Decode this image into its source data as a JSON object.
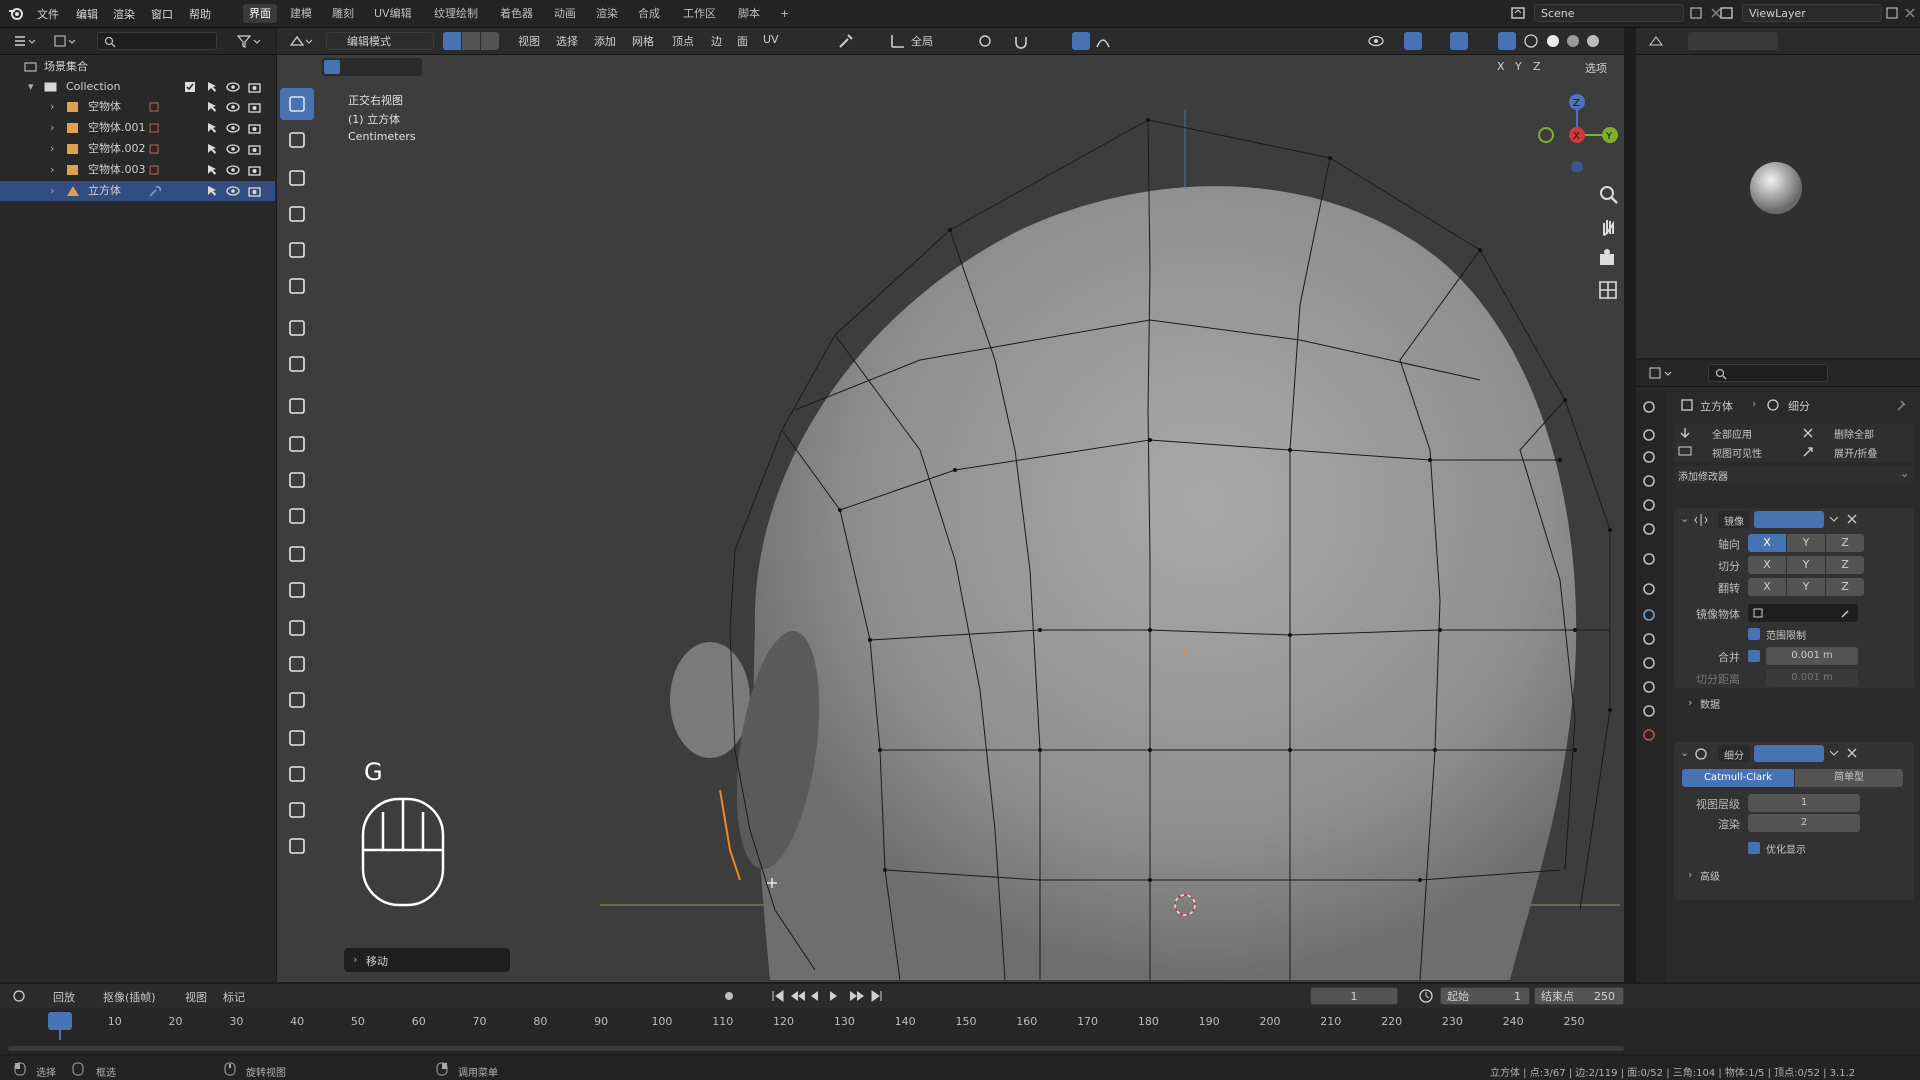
{
  "menubar": {
    "menus": [
      "文件",
      "编辑",
      "渲染",
      "窗口",
      "帮助"
    ],
    "workspaces": [
      "界面",
      "建模",
      "雕刻",
      "UV编辑",
      "纹理绘制",
      "着色器",
      "动画",
      "渲染",
      "合成",
      "工作区",
      "脚本",
      "+"
    ],
    "active_workspace": "界面",
    "scene_label": "Scene",
    "viewlayer_label": "ViewLayer"
  },
  "outliner": {
    "root": "场景集合",
    "collection": "Collection",
    "items": [
      "空物体",
      "空物体.001",
      "空物体.002",
      "空物体.003",
      "立方体"
    ],
    "selected_item": "立方体"
  },
  "viewport_header": {
    "mode": "编辑模式",
    "menus": [
      "视图",
      "选择",
      "添加",
      "网格",
      "顶点",
      "边",
      "面",
      "UV"
    ],
    "transform_orientation": "全局",
    "axis_labels": [
      "X",
      "Y",
      "Z"
    ],
    "options": "选项"
  },
  "viewport": {
    "view_name": "正交右视图",
    "object_label": "(1) 立方体",
    "units": "Centimeters",
    "key_hint": "G",
    "last_operator": "移动"
  },
  "properties": {
    "breadcrumb_object": "立方体",
    "breadcrumb_modifier": "细分",
    "apply_all": "全部应用",
    "delete_all": "删除全部",
    "viewport_vis": "视图可见性",
    "expand_collapse": "展开/折叠",
    "add_modifier": "添加修改器",
    "mirror": {
      "name": "镜像",
      "axis_label": "轴向",
      "bisect_label": "切分",
      "flip_label": "翻转",
      "mirror_object_label": "镜像物体",
      "clipping_label": "范围限制",
      "merge_label": "合并",
      "merge_value": "0.001 m",
      "bisect_dist_label": "切分距离",
      "bisect_dist_value": "0.001 m",
      "data_label": "数据"
    },
    "subdivision": {
      "name": "细分",
      "mode_catmull": "Catmull-Clark",
      "mode_simple": "简单型",
      "viewport_levels_label": "视图层级",
      "viewport_levels_value": "1",
      "render_label": "渲染",
      "render_value": "2",
      "optimal_display_label": "优化显示",
      "advanced_label": "高级"
    }
  },
  "timeline": {
    "menus": [
      "回放",
      "抠像(插帧)",
      "视图",
      "标记"
    ],
    "current_frame": "1",
    "start_label": "起始",
    "start_value": "1",
    "end_label": "结束点",
    "end_value": "250",
    "ticks": [
      "1",
      "10",
      "20",
      "30",
      "40",
      "50",
      "60",
      "70",
      "80",
      "90",
      "100",
      "110",
      "120",
      "130",
      "140",
      "150",
      "160",
      "170",
      "180",
      "190",
      "200",
      "210",
      "220",
      "230",
      "240",
      "250"
    ]
  },
  "statusbar": {
    "select": "选择",
    "box_select": "框选",
    "rotate_view": "旋转视图",
    "call_menu": "调用菜单",
    "stats": "立方体 | 点:3/67 | 边:2/119 | 面:0/52 | 三角:104 | 物体:1/5 | 顶点:0/52 | 3.1.2"
  },
  "colors": {
    "accent": "#4772b3",
    "selection": "#334d80",
    "viewport_bg": "#3d3d3d",
    "edge_select": "#e8892a"
  },
  "icons": [
    "blender-logo-icon",
    "search-icon",
    "filter-icon",
    "eye-icon",
    "camera-icon",
    "cursor-icon",
    "select-box-icon",
    "move-icon",
    "rotate-icon",
    "scale-icon",
    "transform-icon",
    "annotate-icon",
    "measure-icon",
    "add-cube-icon",
    "extrude-icon",
    "inset-icon",
    "bevel-icon",
    "loopcut-icon",
    "knife-icon",
    "polybuild-icon",
    "spin-icon",
    "smooth-icon",
    "edge-slide-icon",
    "shrink-icon",
    "shear-icon",
    "rip-icon",
    "zoom-icon",
    "pan-hand-icon",
    "camera-view-icon",
    "grid-view-icon",
    "wrench-icon",
    "mouse-icon"
  ]
}
